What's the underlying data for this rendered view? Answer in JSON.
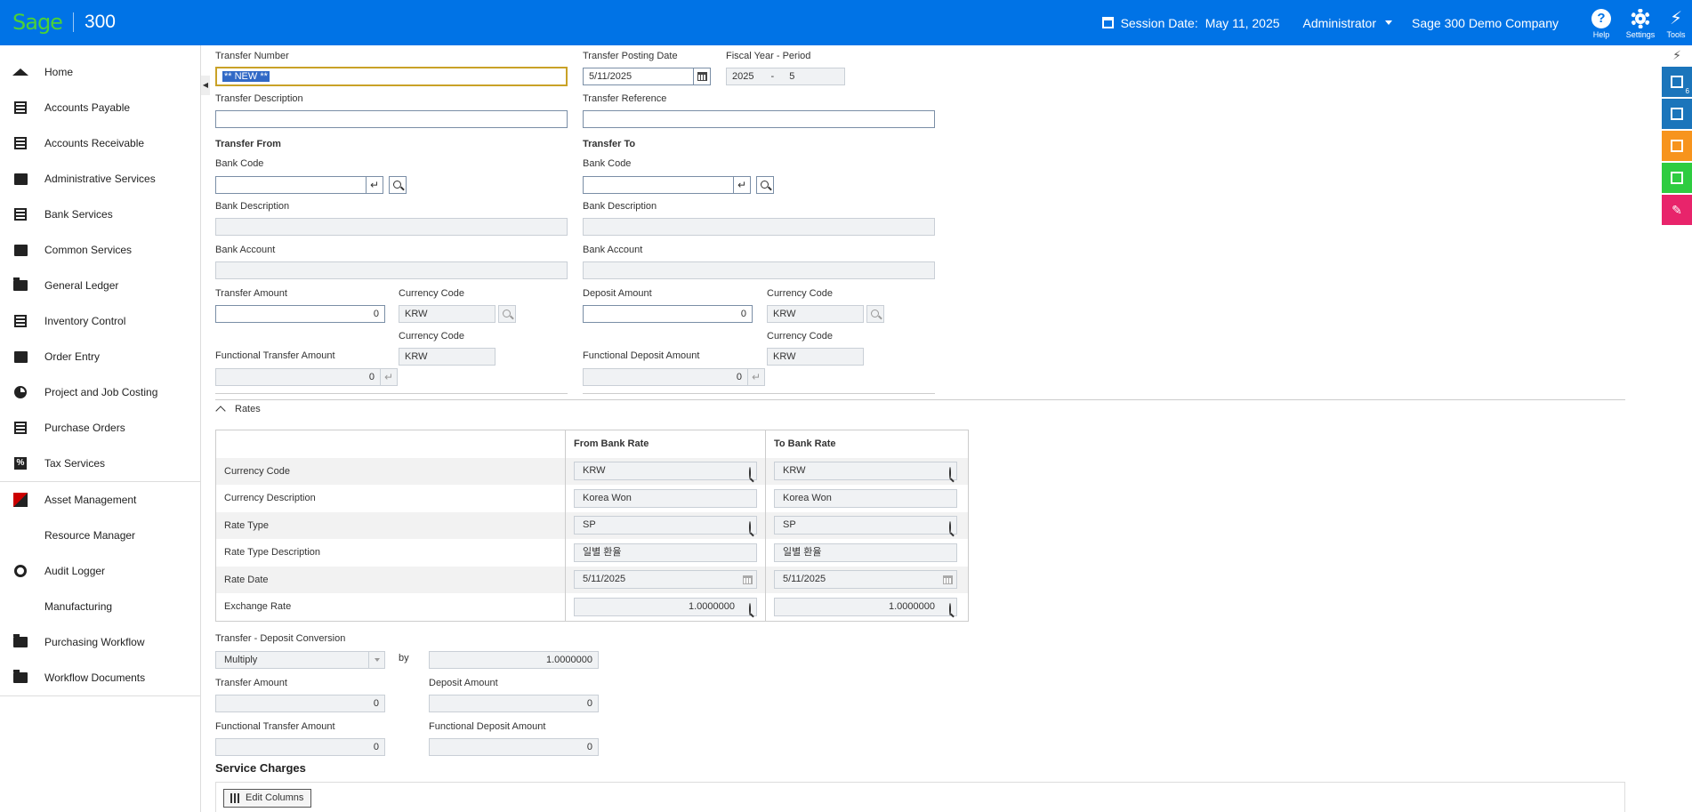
{
  "header": {
    "logo_brand": "Sage",
    "logo_product": "300",
    "session_label": "Session Date:",
    "session_date": "May 11, 2025",
    "user": "Administrator",
    "company": "Sage 300 Demo Company",
    "help_label": "Help",
    "settings_label": "Settings",
    "tools_label": "Tools"
  },
  "sidebar": {
    "items": [
      {
        "label": "Home",
        "icon": "home-icon"
      },
      {
        "label": "Accounts Payable",
        "icon": "accounts-payable-icon"
      },
      {
        "label": "Accounts Receivable",
        "icon": "accounts-receivable-icon"
      },
      {
        "label": "Administrative Services",
        "icon": "lock-icon"
      },
      {
        "label": "Bank Services",
        "icon": "bank-icon"
      },
      {
        "label": "Common Services",
        "icon": "briefcase-icon"
      },
      {
        "label": "General Ledger",
        "icon": "folder-icon"
      },
      {
        "label": "Inventory Control",
        "icon": "inventory-icon"
      },
      {
        "label": "Order Entry",
        "icon": "order-entry-icon"
      },
      {
        "label": "Project and Job Costing",
        "icon": "pie-chart-icon"
      },
      {
        "label": "Purchase Orders",
        "icon": "purchase-orders-icon"
      },
      {
        "label": "Tax Services",
        "icon": "percent-icon"
      },
      {
        "label": "Asset Management",
        "icon": "asset-management-icon"
      },
      {
        "label": "Resource Manager",
        "icon": ""
      },
      {
        "label": "Audit Logger",
        "icon": "gear-icon"
      },
      {
        "label": "Manufacturing",
        "icon": ""
      },
      {
        "label": "Purchasing Workflow",
        "icon": "folder-icon"
      },
      {
        "label": "Workflow Documents",
        "icon": "folder-icon"
      }
    ]
  },
  "form": {
    "transfer_number_label": "Transfer Number",
    "transfer_number": "** NEW **",
    "posting_date_label": "Transfer Posting Date",
    "posting_date": "5/11/2025",
    "fiscal_label": "Fiscal Year - Period",
    "fiscal_year": "2025",
    "fiscal_dash": "-",
    "fiscal_period": "5",
    "description_label": "Transfer Description",
    "description": "",
    "reference_label": "Transfer Reference",
    "reference": "",
    "from": {
      "title": "Transfer From",
      "bank_code_label": "Bank Code",
      "bank_code": "",
      "bank_desc_label": "Bank Description",
      "bank_desc": "",
      "bank_account_label": "Bank Account",
      "bank_account": "",
      "amount_label": "Transfer Amount",
      "amount": "0",
      "currency_label": "Currency Code",
      "currency": "KRW",
      "func_amount_label": "Functional Transfer Amount",
      "func_amount": "0",
      "func_currency_label": "Currency Code",
      "func_currency": "KRW"
    },
    "to": {
      "title": "Transfer To",
      "bank_code_label": "Bank Code",
      "bank_code": "",
      "bank_desc_label": "Bank Description",
      "bank_desc": "",
      "bank_account_label": "Bank Account",
      "bank_account": "",
      "amount_label": "Deposit Amount",
      "amount": "0",
      "currency_label": "Currency Code",
      "currency": "KRW",
      "func_amount_label": "Functional Deposit Amount",
      "func_amount": "0",
      "func_currency_label": "Currency Code",
      "func_currency": "KRW"
    }
  },
  "rates": {
    "toggle_label": "Rates",
    "col_from": "From Bank Rate",
    "col_to": "To Bank Rate",
    "rows": [
      {
        "label": "Currency Code",
        "from": "KRW",
        "to": "KRW",
        "icon": "search-icon"
      },
      {
        "label": "Currency Description",
        "from": "Korea Won",
        "to": "Korea Won",
        "icon": ""
      },
      {
        "label": "Rate Type",
        "from": "SP",
        "to": "SP",
        "icon": "search-icon"
      },
      {
        "label": "Rate Type Description",
        "from": "일별 환율",
        "to": "일별 환율",
        "icon": ""
      },
      {
        "label": "Rate Date",
        "from": "5/11/2025",
        "to": "5/11/2025",
        "icon": "calendar-icon"
      },
      {
        "label": "Exchange Rate",
        "from": "1.0000000",
        "to": "1.0000000",
        "icon": "search-icon"
      }
    ]
  },
  "conversion": {
    "title": "Transfer - Deposit Conversion",
    "operator": "Multiply",
    "by_label": "by",
    "factor": "1.0000000",
    "transfer_amount_label": "Transfer Amount",
    "transfer_amount": "0",
    "deposit_amount_label": "Deposit Amount",
    "deposit_amount": "0",
    "func_transfer_label": "Functional Transfer Amount",
    "func_transfer": "0",
    "func_deposit_label": "Functional Deposit Amount",
    "func_deposit": "0"
  },
  "service_charges": {
    "title": "Service Charges",
    "edit_columns": "Edit Columns"
  },
  "rail": {
    "badge_count": "6",
    "colors": [
      "#1b75bb",
      "#1b75bb",
      "#f7941d",
      "#2ecc40",
      "#e8246b"
    ]
  }
}
